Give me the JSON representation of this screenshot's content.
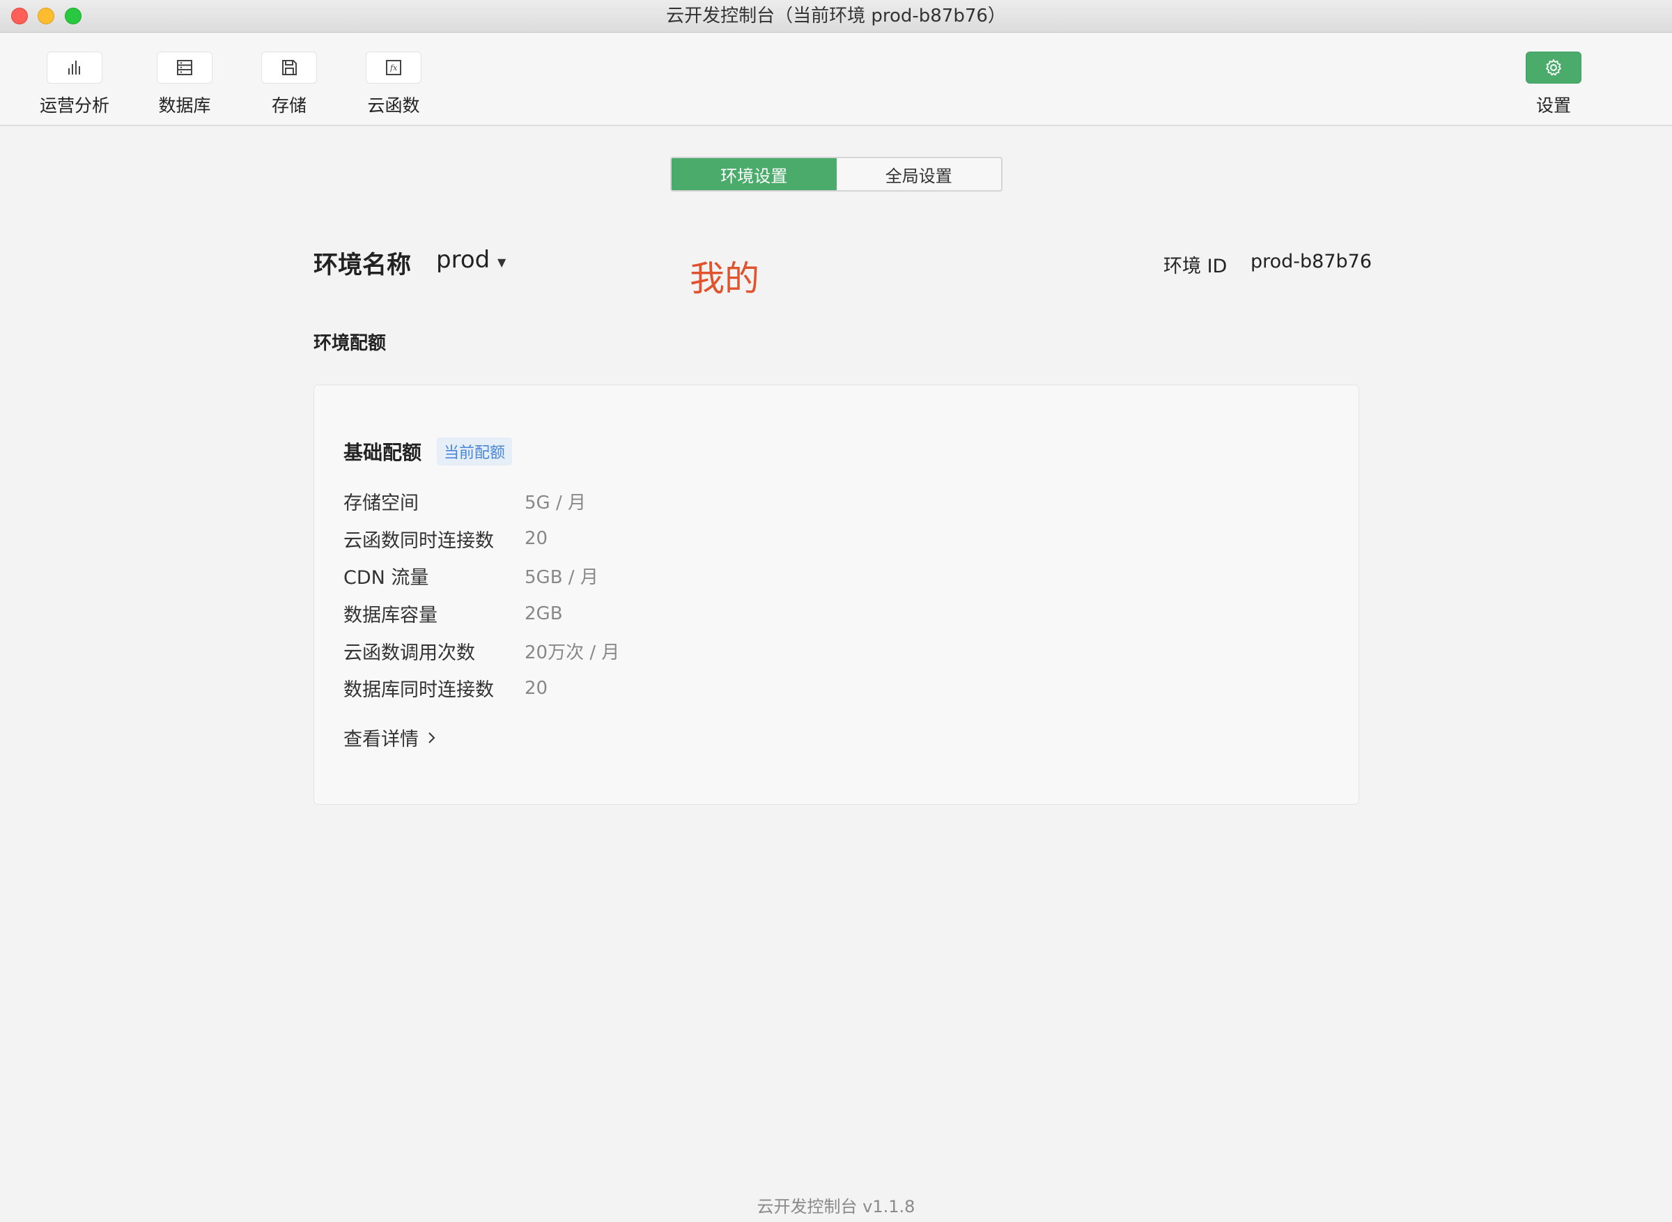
{
  "window": {
    "title": "云开发控制台（当前环境 prod-b87b76）"
  },
  "toolbar": {
    "items": [
      {
        "label": "运营分析",
        "icon": "bar-chart-icon"
      },
      {
        "label": "数据库",
        "icon": "database-icon"
      },
      {
        "label": "存储",
        "icon": "storage-icon"
      },
      {
        "label": "云函数",
        "icon": "function-icon"
      }
    ],
    "settings": {
      "label": "设置",
      "icon": "gear-icon"
    }
  },
  "tabs": [
    {
      "label": "环境设置",
      "active": true
    },
    {
      "label": "全局设置",
      "active": false
    }
  ],
  "env": {
    "name_label": "环境名称",
    "name_value": "prod",
    "id_label": "环境 ID",
    "id_value": "prod-b87b76"
  },
  "annotation": "我的",
  "quota_section": {
    "title": "环境配额",
    "card_title": "基础配额",
    "badge": "当前配额",
    "rows": [
      {
        "label": "存储空间",
        "value": "5G / 月"
      },
      {
        "label": "云函数同时连接数",
        "value": "20"
      },
      {
        "label": "CDN 流量",
        "value": "5GB / 月"
      },
      {
        "label": "数据库容量",
        "value": "2GB"
      },
      {
        "label": "云函数调用次数",
        "value": "20万次 / 月"
      },
      {
        "label": "数据库同时连接数",
        "value": "20"
      }
    ],
    "details_link": "查看详情"
  },
  "footer": {
    "version": "云开发控制台 v1.1.8"
  },
  "colors": {
    "accent_green": "#4aab6b",
    "badge_blue": "#4a86d8",
    "annotation_red": "#e0532c"
  }
}
